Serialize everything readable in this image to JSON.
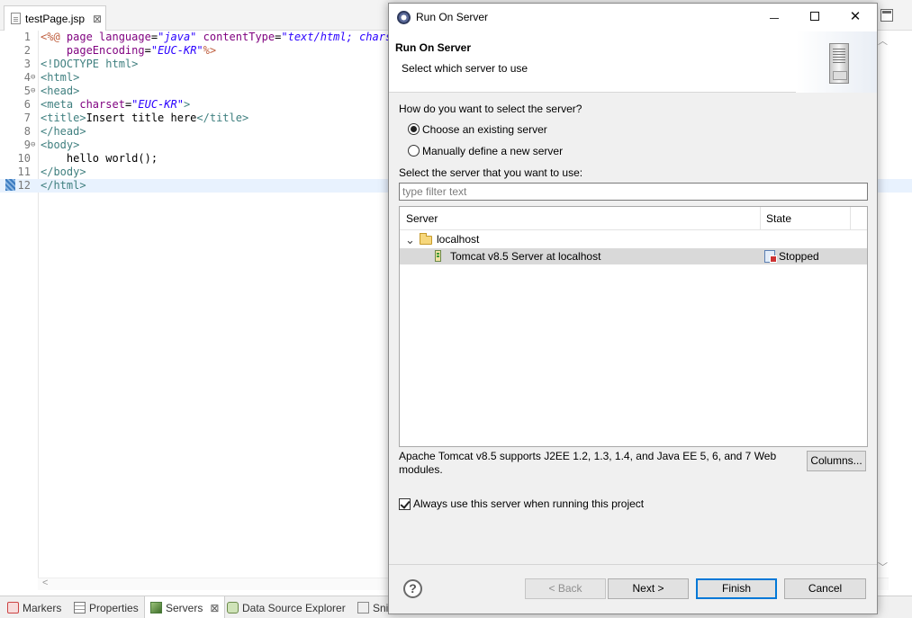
{
  "editor": {
    "tab_label": "testPage.jsp",
    "tab_close": "⊠",
    "lines": [
      {
        "num": "1",
        "fold": "",
        "current": false,
        "parts": [
          [
            "t-jsp",
            "<%@ "
          ],
          [
            "t-attr",
            "page "
          ],
          [
            "t-attr",
            "language"
          ],
          [
            "t-plain",
            "="
          ],
          [
            "t-str",
            "\"java\""
          ],
          [
            "t-plain",
            " "
          ],
          [
            "t-attr",
            "contentType"
          ],
          [
            "t-plain",
            "="
          ],
          [
            "t-str",
            "\"text/html; charset=EUC-KR\""
          ]
        ]
      },
      {
        "num": "2",
        "fold": "",
        "current": false,
        "parts": [
          [
            "t-plain",
            "    "
          ],
          [
            "t-attr",
            "pageEncoding"
          ],
          [
            "t-plain",
            "="
          ],
          [
            "t-str",
            "\"EUC-KR\""
          ],
          [
            "t-jsp",
            "%>"
          ]
        ]
      },
      {
        "num": "3",
        "fold": "",
        "current": false,
        "parts": [
          [
            "t-tag",
            "<!DOCTYPE html>"
          ]
        ]
      },
      {
        "num": "4",
        "fold": "⊖",
        "current": false,
        "parts": [
          [
            "t-tag",
            "<html>"
          ]
        ]
      },
      {
        "num": "5",
        "fold": "⊖",
        "current": false,
        "parts": [
          [
            "t-tag",
            "<head>"
          ]
        ]
      },
      {
        "num": "6",
        "fold": "",
        "current": false,
        "parts": [
          [
            "t-tag",
            "<meta "
          ],
          [
            "t-attr",
            "charset"
          ],
          [
            "t-plain",
            "="
          ],
          [
            "t-str",
            "\"EUC-KR\""
          ],
          [
            "t-tag",
            ">"
          ]
        ]
      },
      {
        "num": "7",
        "fold": "",
        "current": false,
        "parts": [
          [
            "t-tag",
            "<title>"
          ],
          [
            "t-plain",
            "Insert title here"
          ],
          [
            "t-tag",
            "</title>"
          ]
        ]
      },
      {
        "num": "8",
        "fold": "",
        "current": false,
        "parts": [
          [
            "t-tag",
            "</head>"
          ]
        ]
      },
      {
        "num": "9",
        "fold": "⊖",
        "current": false,
        "parts": [
          [
            "t-tag",
            "<body>"
          ]
        ]
      },
      {
        "num": "10",
        "fold": "",
        "current": false,
        "parts": [
          [
            "t-plain",
            "    hello world();"
          ]
        ]
      },
      {
        "num": "11",
        "fold": "",
        "current": false,
        "parts": [
          [
            "t-tag",
            "</body>"
          ]
        ]
      },
      {
        "num": "12",
        "fold": "",
        "current": true,
        "parts": [
          [
            "t-tag",
            "</html>"
          ]
        ]
      }
    ]
  },
  "bottom_tabs": [
    {
      "label": "Markers",
      "active": false
    },
    {
      "label": "Properties",
      "active": false
    },
    {
      "label": "Servers",
      "active": true,
      "close": "⊠"
    },
    {
      "label": "Data Source Explorer",
      "active": false
    },
    {
      "label": "Snippets",
      "active": false
    }
  ],
  "dialog": {
    "window_title": "Run On Server",
    "window_controls": {
      "close": "✕"
    },
    "header_title": "Run On Server",
    "header_subtitle": "Select which server to use",
    "question": "How do you want to select the server?",
    "radio_existing": "Choose an existing server",
    "radio_existing_selected": true,
    "radio_manual": "Manually define a new server",
    "radio_manual_selected": false,
    "select_label": "Select the server that you want to use:",
    "filter_placeholder": "type filter text",
    "table": {
      "columns": [
        "Server",
        "State"
      ],
      "group": {
        "chevron": "⌄",
        "label": "localhost"
      },
      "rows": [
        {
          "server": "Tomcat v8.5 Server at localhost",
          "state": "Stopped",
          "selected": true
        }
      ]
    },
    "description": "Apache Tomcat v8.5 supports J2EE 1.2, 1.3, 1.4, and Java EE 5, 6, and 7 Web modules.",
    "columns_button": "Columns...",
    "always_use_label": "Always use this server when running this project",
    "always_use_checked": true,
    "help_button": "?",
    "back_button": "< Back",
    "next_button": "Next >",
    "finish_button": "Finish",
    "cancel_button": "Cancel"
  },
  "colors": {
    "dialog_bg": "#f0f0f0",
    "default_button_border": "#0078d7",
    "selection_row": "#d9d9d9",
    "code_tag": "#3f7f7f",
    "code_attr": "#7f007f",
    "code_string": "#2a00ff"
  }
}
